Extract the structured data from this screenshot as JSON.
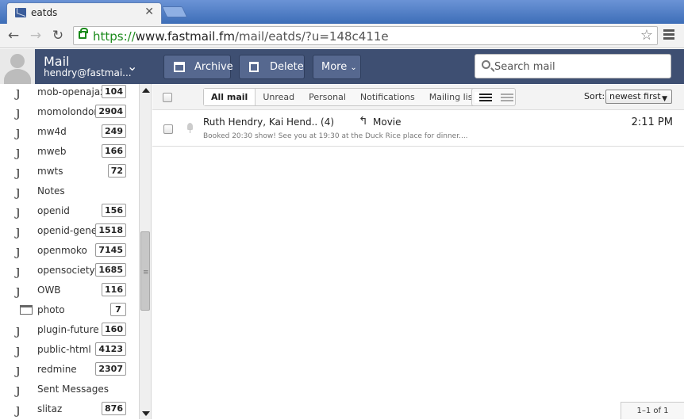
{
  "browser": {
    "tab_title": "eatds",
    "url": {
      "scheme": "https://",
      "host": "www.fastmail.fm",
      "path": "/mail/eatds/?u=148c411e"
    }
  },
  "account": {
    "title": "Mail",
    "user": "hendry@fastmai..."
  },
  "actions": {
    "archive": "Archive",
    "delete": "Delete",
    "more": "More"
  },
  "search": {
    "placeholder": "Search mail"
  },
  "sidebar": {
    "folders": [
      {
        "name": "mob-openajax",
        "count": "104",
        "icon": "label-hook-icon"
      },
      {
        "name": "momolondon",
        "count": "2904",
        "icon": "label-hook-icon"
      },
      {
        "name": "mw4d",
        "count": "249",
        "icon": "label-hook-icon"
      },
      {
        "name": "mweb",
        "count": "166",
        "icon": "label-hook-icon"
      },
      {
        "name": "mwts",
        "count": "72",
        "icon": "label-hook-icon"
      },
      {
        "name": "Notes",
        "count": "",
        "icon": "label-hook-icon"
      },
      {
        "name": "openid",
        "count": "156",
        "icon": "label-hook-icon"
      },
      {
        "name": "openid-gene..",
        "count": "1518",
        "icon": "label-hook-icon"
      },
      {
        "name": "openmoko",
        "count": "7145",
        "icon": "label-hook-icon"
      },
      {
        "name": "opensociety",
        "count": "1685",
        "icon": "label-hook-icon"
      },
      {
        "name": "OWB",
        "count": "116",
        "icon": "label-hook-icon"
      },
      {
        "name": "photo",
        "count": "7",
        "icon": "folder-icon"
      },
      {
        "name": "plugin-future",
        "count": "160",
        "icon": "label-hook-icon"
      },
      {
        "name": "public-html",
        "count": "4123",
        "icon": "label-hook-icon"
      },
      {
        "name": "redmine",
        "count": "2307",
        "icon": "label-hook-icon"
      },
      {
        "name": "Sent Messages",
        "count": "",
        "icon": "label-hook-icon"
      },
      {
        "name": "slitaz",
        "count": "876",
        "icon": "label-hook-icon"
      }
    ]
  },
  "filters": {
    "tabs": [
      "All mail",
      "Unread",
      "Personal",
      "Notifications",
      "Mailing lists"
    ],
    "active": "All mail"
  },
  "sort": {
    "label": "Sort:",
    "value": "newest first"
  },
  "messages": [
    {
      "from": "Ruth Hendry, Kai Hend.. (4)",
      "subject": "Movie",
      "time": "2:11 PM",
      "preview": "Booked 20:30 show! See you at 19:30 at the Duck Rice place for dinner...."
    }
  ],
  "pager": "1–1 of 1"
}
